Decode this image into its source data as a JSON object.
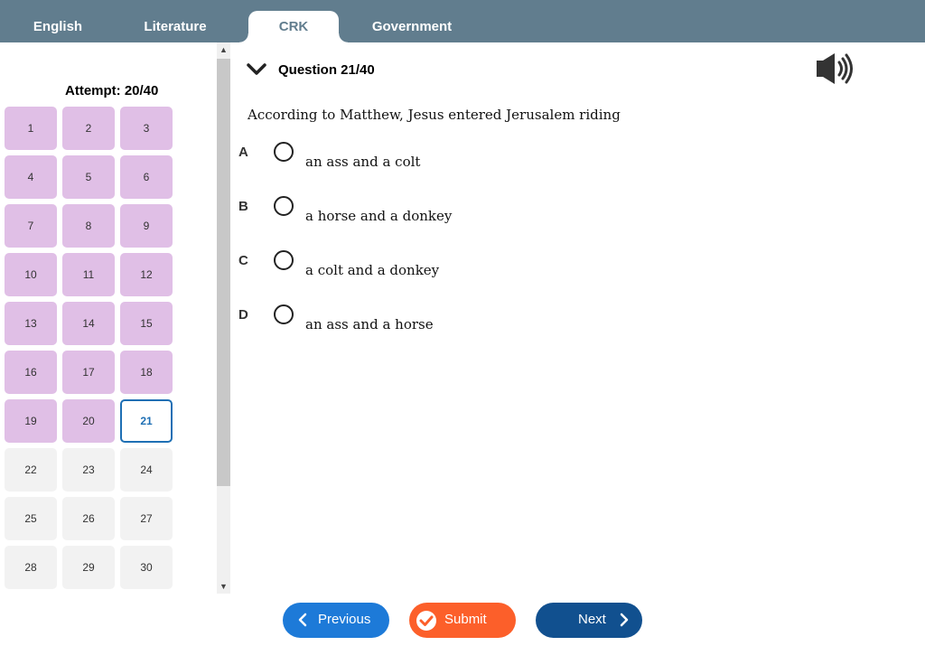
{
  "tabs": [
    {
      "label": "English",
      "active": false
    },
    {
      "label": "Literature",
      "active": false
    },
    {
      "label": "CRK",
      "active": true
    },
    {
      "label": "Government",
      "active": false
    }
  ],
  "navigator": {
    "attempt_label": "Attempt: 20/40",
    "answered": [
      "1",
      "2",
      "3",
      "4",
      "5",
      "6",
      "7",
      "8",
      "9",
      "10",
      "11",
      "12",
      "13",
      "14",
      "15",
      "16",
      "17",
      "18",
      "19",
      "20"
    ],
    "current": "21",
    "unanswered_visible": [
      "22",
      "23",
      "24",
      "25",
      "26",
      "27",
      "28",
      "29",
      "30"
    ]
  },
  "question": {
    "number_label": "Question 21/40",
    "text": "According to Matthew, Jesus entered Jerusalem riding",
    "options": [
      {
        "letter": "A",
        "text": "an ass and a colt"
      },
      {
        "letter": "B",
        "text": "a horse and a donkey"
      },
      {
        "letter": "C",
        "text": "a colt and a donkey"
      },
      {
        "letter": "D",
        "text": "an ass and a horse"
      }
    ]
  },
  "buttons": {
    "previous": "Previous",
    "submit": "Submit",
    "next": "Next"
  },
  "icons": {
    "collapse": "chevron-down-icon",
    "audio": "speaker-icon",
    "previous": "chevron-left-icon",
    "submit": "check-circle-icon",
    "next": "chevron-right-icon"
  },
  "colors": {
    "tabbar": "#617d8e",
    "answered_cell": "#e0bfe6",
    "unanswered_cell": "#f2f2f2",
    "current_cell_border": "#1e6fb4",
    "previous_button": "#1d7ad8",
    "submit_button": "#fc5f2a",
    "next_button": "#11508f"
  }
}
